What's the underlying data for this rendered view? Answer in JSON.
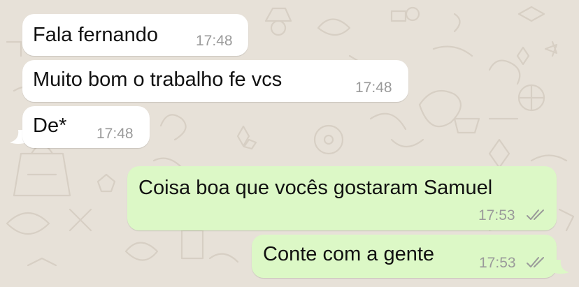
{
  "colors": {
    "wallpaper": "#e7e1d8",
    "incoming_bubble": "#ffffff",
    "outgoing_bubble": "#dcf8c6",
    "timestamp": "#9a9a9a",
    "text": "#111111"
  },
  "messages": [
    {
      "direction": "incoming",
      "text": "Fala fernando",
      "time": "17:48"
    },
    {
      "direction": "incoming",
      "text": "Muito bom o trabalho fe vcs",
      "time": "17:48"
    },
    {
      "direction": "incoming",
      "text": "De*",
      "time": "17:48"
    },
    {
      "direction": "outgoing",
      "text": "Coisa boa que vocês gostaram Samuel",
      "time": "17:53",
      "status_icon": "double-check-icon"
    },
    {
      "direction": "outgoing",
      "text": "Conte com a gente",
      "time": "17:53",
      "status_icon": "double-check-icon"
    }
  ]
}
